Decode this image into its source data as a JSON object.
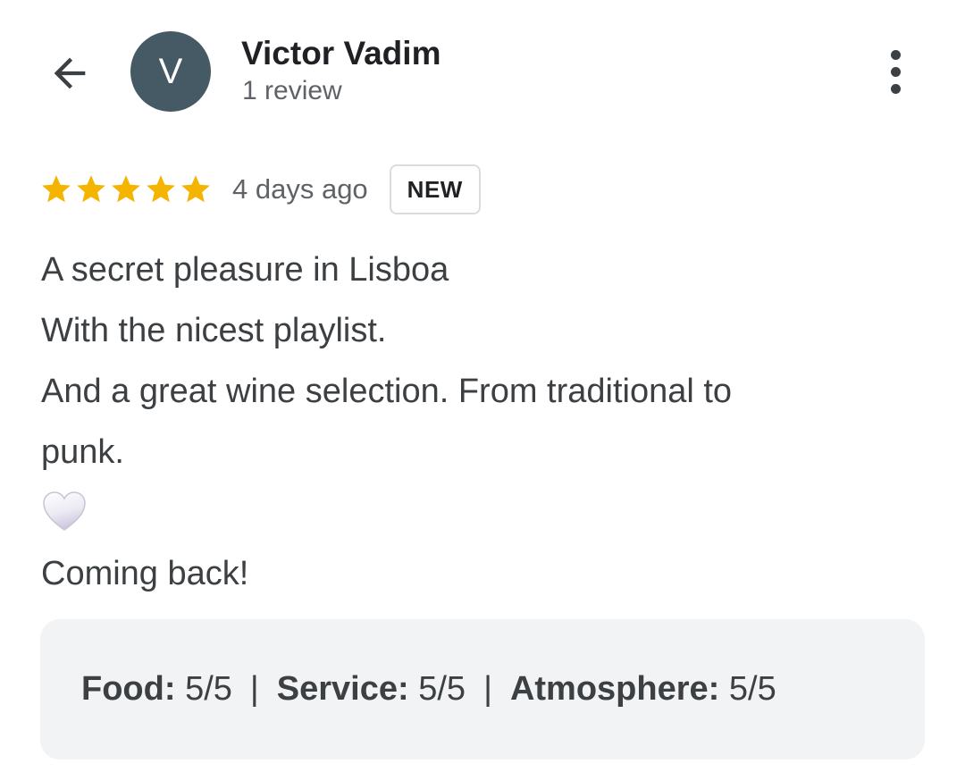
{
  "header": {
    "back_icon": "arrow-back-icon",
    "avatar_initial": "V",
    "avatar_color": "#455a64",
    "author_name": "Victor Vadim",
    "author_meta": "1 review",
    "more_icon": "more-vert-icon"
  },
  "rating": {
    "stars": 5,
    "max_stars": 5,
    "star_color": "#f4b400",
    "time_ago": "4 days ago",
    "badge": "NEW"
  },
  "review": {
    "lines": [
      "A secret pleasure in Lisboa",
      "With the nicest playlist.",
      "And a great wine selection. From traditional to",
      "punk."
    ],
    "emoji_icon": "white-heart-icon",
    "closing": "Coming back!"
  },
  "sub_ratings": [
    {
      "label": "Food:",
      "value": "5/5"
    },
    {
      "label": "Service:",
      "value": "5/5"
    },
    {
      "label": "Atmosphere:",
      "value": "5/5"
    }
  ],
  "separator": "|"
}
